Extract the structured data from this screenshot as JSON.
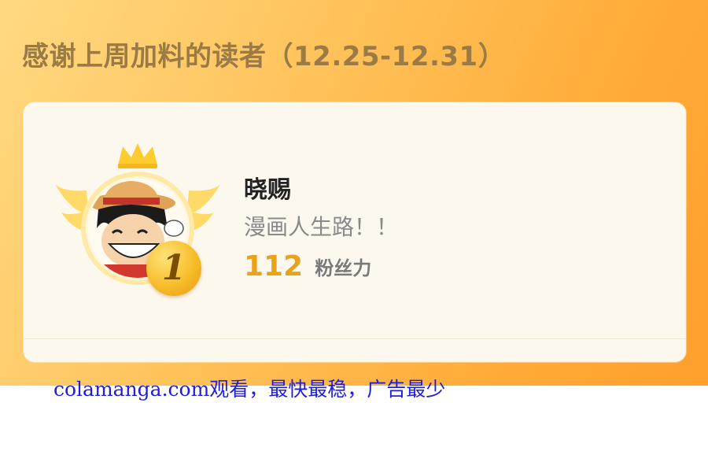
{
  "header": {
    "title": "感谢上周加料的读者（12.25-12.31）"
  },
  "reader": {
    "rank": "1",
    "name": "晓赐",
    "motto": "漫画人生路！！",
    "fan_power_value": "112",
    "fan_power_label": "粉丝力",
    "avatar_icon": "cartoon-avatar-straw-hat"
  },
  "watermark": {
    "text": "colamanga.com观看，最快最稳，广告最少"
  },
  "colors": {
    "banner": "#ffb43f",
    "card": "#fcf8ee",
    "accent": "#e9a21b",
    "watermark": "#1f1fd6"
  }
}
